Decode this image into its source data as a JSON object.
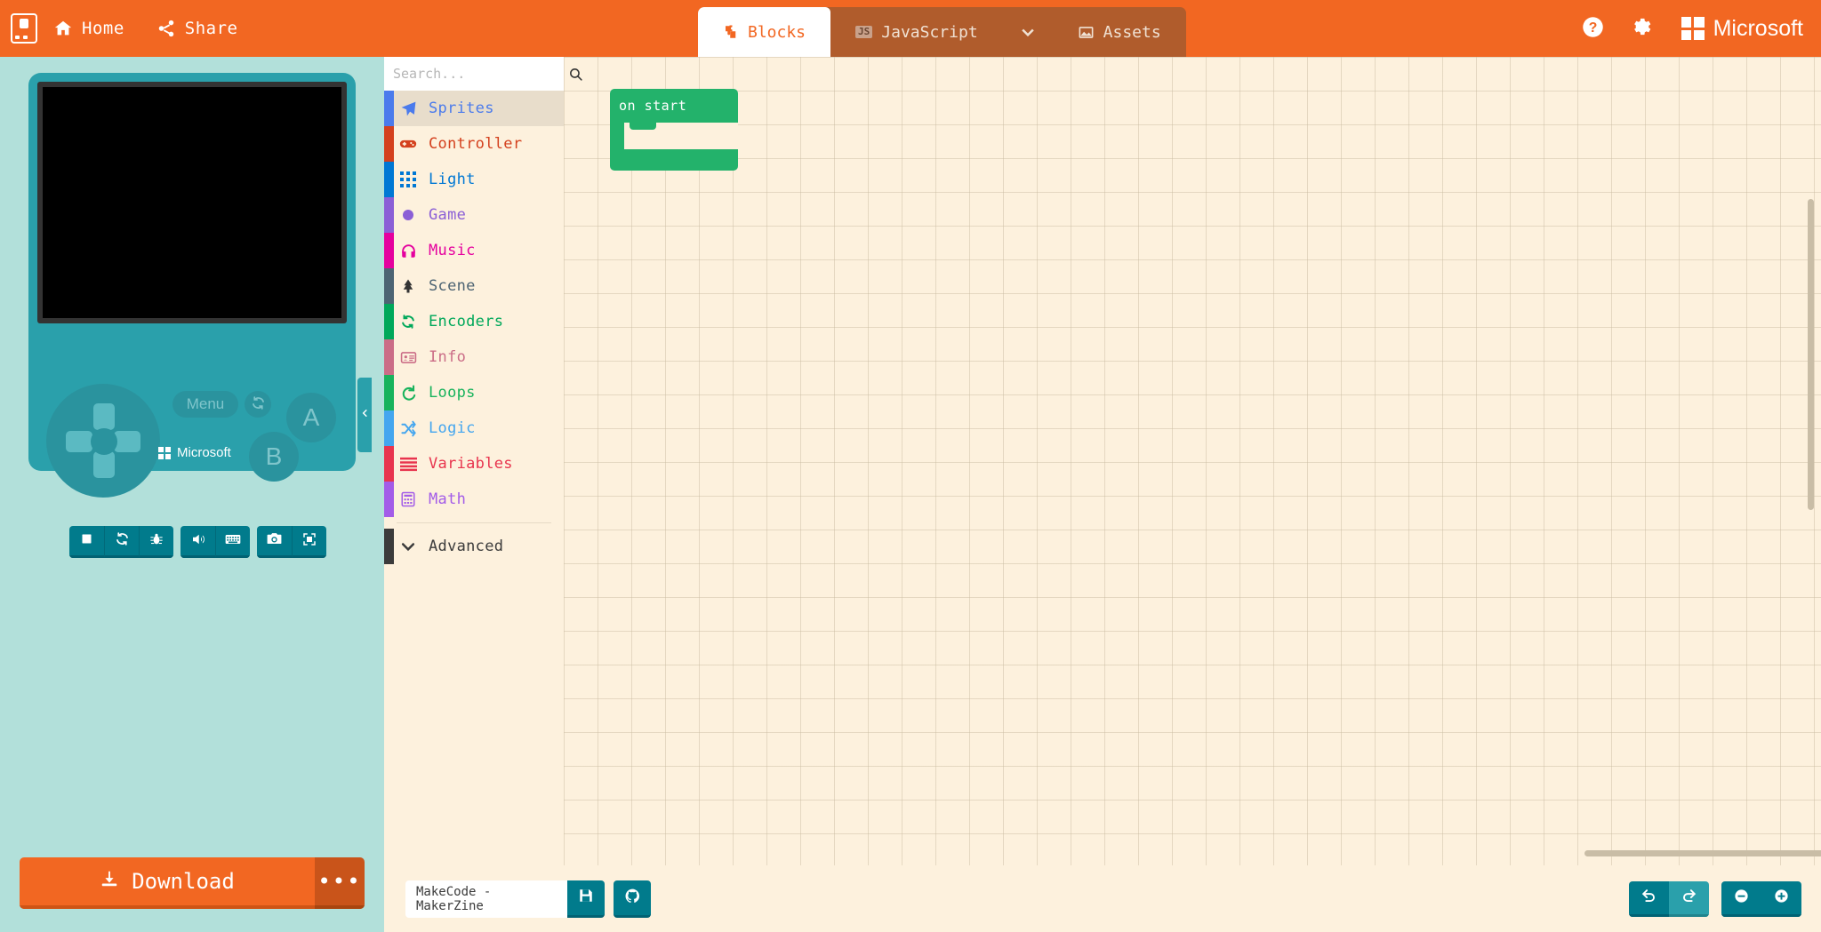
{
  "header": {
    "logo_icon": "arcade-gamepad-icon",
    "home": {
      "label": "Home",
      "icon": "home-icon"
    },
    "share": {
      "label": "Share",
      "icon": "share-icon"
    },
    "tabs": [
      {
        "label": "Blocks",
        "icon": "puzzle-piece-icon",
        "active": true
      },
      {
        "label": "JavaScript",
        "icon": "js-icon",
        "active": false
      },
      {
        "label": "Assets",
        "icon": "image-icon",
        "active": false
      }
    ],
    "dropdown_icon": "chevron-down-icon",
    "help_icon": "help-circle-icon",
    "settings_icon": "gear-icon",
    "brand": "Microsoft"
  },
  "simulator": {
    "menu_label": "Menu",
    "reset_icon": "refresh-icon",
    "button_a": "A",
    "button_b": "B",
    "brand": "Microsoft",
    "toolbar": [
      {
        "name": "stop-button",
        "icon": "stop-square-icon"
      },
      {
        "name": "restart-button",
        "icon": "refresh-icon"
      },
      {
        "name": "debug-button",
        "icon": "bug-icon"
      },
      {
        "name": "mute-button",
        "icon": "speaker-icon"
      },
      {
        "name": "keyboard-button",
        "icon": "keyboard-icon"
      },
      {
        "name": "screenshot-button",
        "icon": "camera-icon"
      },
      {
        "name": "fullscreen-button",
        "icon": "expand-icon"
      }
    ]
  },
  "download": {
    "label": "Download",
    "icon": "download-icon",
    "more": "•••"
  },
  "toolbox": {
    "search_placeholder": "Search...",
    "search_icon": "search-icon",
    "categories": [
      {
        "label": "Sprites",
        "color": "#4b7bec",
        "icon": "paper-plane-icon",
        "selected": true
      },
      {
        "label": "Controller",
        "color": "#d4411e",
        "icon": "gamepad-icon",
        "selected": false
      },
      {
        "label": "Light",
        "color": "#0078d4",
        "icon": "grid-dots-icon",
        "selected": false
      },
      {
        "label": "Game",
        "color": "#8b5fd6",
        "icon": "circle-icon",
        "selected": false
      },
      {
        "label": "Music",
        "color": "#e5009e",
        "icon": "headphones-icon",
        "selected": false
      },
      {
        "label": "Scene",
        "color": "#4d6473",
        "icon": "tree-icon",
        "selected": false
      },
      {
        "label": "Encoders",
        "color": "#00a85a",
        "icon": "refresh-icon",
        "selected": false
      },
      {
        "label": "Info",
        "color": "#cb6d87",
        "icon": "id-card-icon",
        "selected": false
      },
      {
        "label": "Loops",
        "color": "#18b35c",
        "icon": "loop-arrow-icon",
        "selected": false
      },
      {
        "label": "Logic",
        "color": "#44a6ef",
        "icon": "shuffle-icon",
        "selected": false
      },
      {
        "label": "Variables",
        "color": "#e8344e",
        "icon": "lines-icon",
        "selected": false
      },
      {
        "label": "Math",
        "color": "#a35ce8",
        "icon": "calculator-icon",
        "selected": false
      }
    ],
    "advanced": {
      "label": "Advanced",
      "icon": "chevron-down-icon"
    },
    "collapse_icon": "chevron-left-icon"
  },
  "workspace": {
    "blocks": [
      {
        "label": "on start",
        "color": "#23b26b",
        "type": "event"
      }
    ]
  },
  "bottom": {
    "project_name": "MakeCode - MakerZine",
    "save_icon": "floppy-disk-icon",
    "github_icon": "github-icon",
    "undo_icon": "undo-arrow-icon",
    "redo_icon": "redo-arrow-icon",
    "zoom_out_icon": "minus-circle-icon",
    "zoom_in_icon": "plus-circle-icon"
  }
}
